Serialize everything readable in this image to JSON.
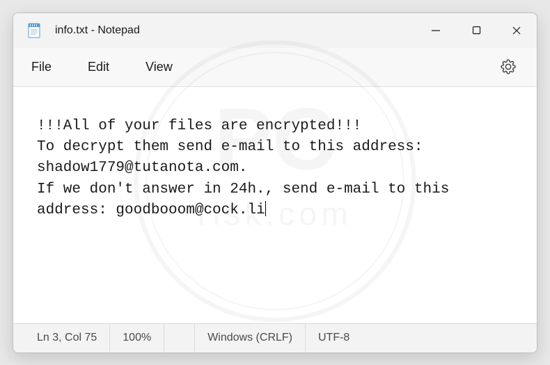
{
  "titlebar": {
    "title": "info.txt - Notepad"
  },
  "menubar": {
    "file": "File",
    "edit": "Edit",
    "view": "View"
  },
  "content": {
    "text": "!!!All of your files are encrypted!!!\nTo decrypt them send e-mail to this address: shadow1779@tutanota.com.\nIf we don't answer in 24h., send e-mail to this address: goodbooom@cock.li"
  },
  "statusbar": {
    "position": "Ln 3, Col 75",
    "zoom": "100%",
    "line_ending": "Windows (CRLF)",
    "encoding": "UTF-8"
  }
}
